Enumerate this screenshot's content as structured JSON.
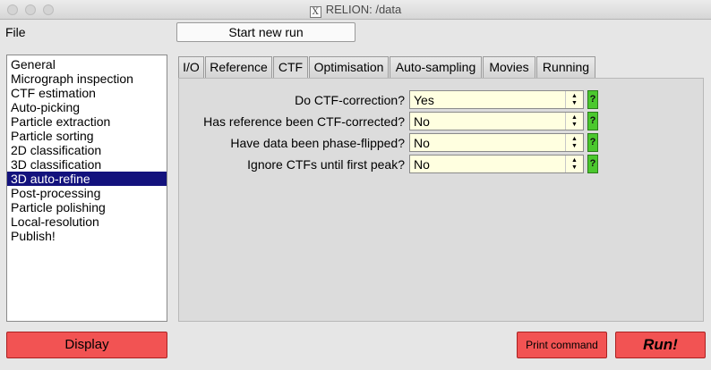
{
  "window": {
    "title": "RELION: /data",
    "x_icon": "X"
  },
  "menu": {
    "file_label": "File"
  },
  "toolbar": {
    "start_new_run_label": "Start new run"
  },
  "jobs": [
    "General",
    "Micrograph inspection",
    "CTF estimation",
    "Auto-picking",
    "Particle extraction",
    "Particle sorting",
    "2D classification",
    "3D classification",
    "3D auto-refine",
    "Post-processing",
    "Particle polishing",
    "Local-resolution",
    "Publish!"
  ],
  "selected_job": "3D auto-refine",
  "tabs": [
    "I/O",
    "Reference",
    "CTF",
    "Optimisation",
    "Auto-sampling",
    "Movies",
    "Running"
  ],
  "active_tab": "CTF",
  "ctf_options": [
    {
      "label": "Do CTF-correction?",
      "value": "Yes",
      "help": "?"
    },
    {
      "label": "Has reference been CTF-corrected?",
      "value": "No",
      "help": "?"
    },
    {
      "label": "Have data been phase-flipped?",
      "value": "No",
      "help": "?"
    },
    {
      "label": "Ignore CTFs until first peak?",
      "value": "No",
      "help": "?"
    }
  ],
  "buttons": {
    "display_label": "Display",
    "print_command_label": "Print command",
    "run_label": "Run!"
  },
  "colors": {
    "selection": "#13127d",
    "red_button": "#f25353",
    "help_button": "#4bc82e",
    "dropdown_bg": "#ffffe0"
  },
  "icons": {
    "close": "close-window-icon",
    "minimize": "minimize-window-icon",
    "maximize": "maximize-window-icon",
    "x11": "x11-icon",
    "dropdown_arrows": "up-down-arrows-icon",
    "help": "help-icon"
  }
}
